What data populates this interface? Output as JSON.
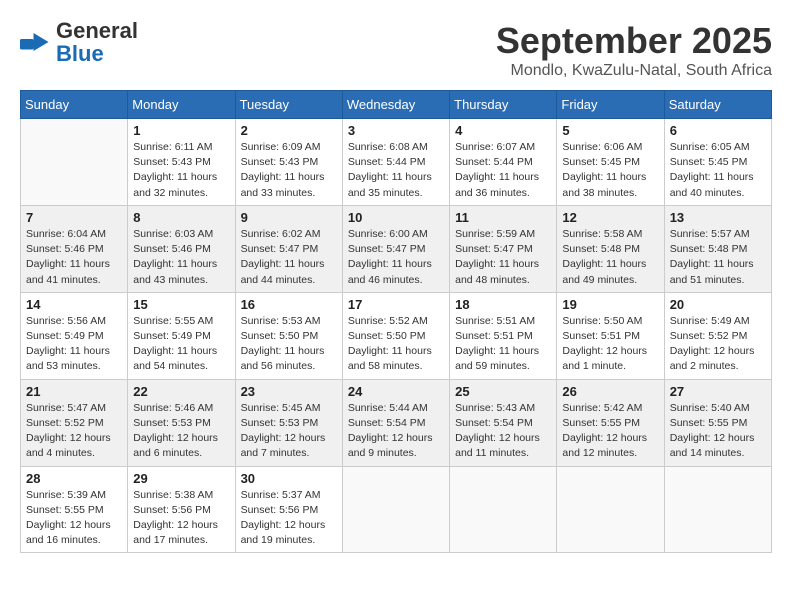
{
  "logo": {
    "text_general": "General",
    "text_blue": "Blue",
    "icon_color": "#1a6bb5"
  },
  "title": "September 2025",
  "location": "Mondlo, KwaZulu-Natal, South Africa",
  "weekdays": [
    "Sunday",
    "Monday",
    "Tuesday",
    "Wednesday",
    "Thursday",
    "Friday",
    "Saturday"
  ],
  "weeks": [
    {
      "shaded": false,
      "days": [
        {
          "num": "",
          "sunrise": "",
          "sunset": "",
          "daylight": ""
        },
        {
          "num": "1",
          "sunrise": "Sunrise: 6:11 AM",
          "sunset": "Sunset: 5:43 PM",
          "daylight": "Daylight: 11 hours and 32 minutes."
        },
        {
          "num": "2",
          "sunrise": "Sunrise: 6:09 AM",
          "sunset": "Sunset: 5:43 PM",
          "daylight": "Daylight: 11 hours and 33 minutes."
        },
        {
          "num": "3",
          "sunrise": "Sunrise: 6:08 AM",
          "sunset": "Sunset: 5:44 PM",
          "daylight": "Daylight: 11 hours and 35 minutes."
        },
        {
          "num": "4",
          "sunrise": "Sunrise: 6:07 AM",
          "sunset": "Sunset: 5:44 PM",
          "daylight": "Daylight: 11 hours and 36 minutes."
        },
        {
          "num": "5",
          "sunrise": "Sunrise: 6:06 AM",
          "sunset": "Sunset: 5:45 PM",
          "daylight": "Daylight: 11 hours and 38 minutes."
        },
        {
          "num": "6",
          "sunrise": "Sunrise: 6:05 AM",
          "sunset": "Sunset: 5:45 PM",
          "daylight": "Daylight: 11 hours and 40 minutes."
        }
      ]
    },
    {
      "shaded": true,
      "days": [
        {
          "num": "7",
          "sunrise": "Sunrise: 6:04 AM",
          "sunset": "Sunset: 5:46 PM",
          "daylight": "Daylight: 11 hours and 41 minutes."
        },
        {
          "num": "8",
          "sunrise": "Sunrise: 6:03 AM",
          "sunset": "Sunset: 5:46 PM",
          "daylight": "Daylight: 11 hours and 43 minutes."
        },
        {
          "num": "9",
          "sunrise": "Sunrise: 6:02 AM",
          "sunset": "Sunset: 5:47 PM",
          "daylight": "Daylight: 11 hours and 44 minutes."
        },
        {
          "num": "10",
          "sunrise": "Sunrise: 6:00 AM",
          "sunset": "Sunset: 5:47 PM",
          "daylight": "Daylight: 11 hours and 46 minutes."
        },
        {
          "num": "11",
          "sunrise": "Sunrise: 5:59 AM",
          "sunset": "Sunset: 5:47 PM",
          "daylight": "Daylight: 11 hours and 48 minutes."
        },
        {
          "num": "12",
          "sunrise": "Sunrise: 5:58 AM",
          "sunset": "Sunset: 5:48 PM",
          "daylight": "Daylight: 11 hours and 49 minutes."
        },
        {
          "num": "13",
          "sunrise": "Sunrise: 5:57 AM",
          "sunset": "Sunset: 5:48 PM",
          "daylight": "Daylight: 11 hours and 51 minutes."
        }
      ]
    },
    {
      "shaded": false,
      "days": [
        {
          "num": "14",
          "sunrise": "Sunrise: 5:56 AM",
          "sunset": "Sunset: 5:49 PM",
          "daylight": "Daylight: 11 hours and 53 minutes."
        },
        {
          "num": "15",
          "sunrise": "Sunrise: 5:55 AM",
          "sunset": "Sunset: 5:49 PM",
          "daylight": "Daylight: 11 hours and 54 minutes."
        },
        {
          "num": "16",
          "sunrise": "Sunrise: 5:53 AM",
          "sunset": "Sunset: 5:50 PM",
          "daylight": "Daylight: 11 hours and 56 minutes."
        },
        {
          "num": "17",
          "sunrise": "Sunrise: 5:52 AM",
          "sunset": "Sunset: 5:50 PM",
          "daylight": "Daylight: 11 hours and 58 minutes."
        },
        {
          "num": "18",
          "sunrise": "Sunrise: 5:51 AM",
          "sunset": "Sunset: 5:51 PM",
          "daylight": "Daylight: 11 hours and 59 minutes."
        },
        {
          "num": "19",
          "sunrise": "Sunrise: 5:50 AM",
          "sunset": "Sunset: 5:51 PM",
          "daylight": "Daylight: 12 hours and 1 minute."
        },
        {
          "num": "20",
          "sunrise": "Sunrise: 5:49 AM",
          "sunset": "Sunset: 5:52 PM",
          "daylight": "Daylight: 12 hours and 2 minutes."
        }
      ]
    },
    {
      "shaded": true,
      "days": [
        {
          "num": "21",
          "sunrise": "Sunrise: 5:47 AM",
          "sunset": "Sunset: 5:52 PM",
          "daylight": "Daylight: 12 hours and 4 minutes."
        },
        {
          "num": "22",
          "sunrise": "Sunrise: 5:46 AM",
          "sunset": "Sunset: 5:53 PM",
          "daylight": "Daylight: 12 hours and 6 minutes."
        },
        {
          "num": "23",
          "sunrise": "Sunrise: 5:45 AM",
          "sunset": "Sunset: 5:53 PM",
          "daylight": "Daylight: 12 hours and 7 minutes."
        },
        {
          "num": "24",
          "sunrise": "Sunrise: 5:44 AM",
          "sunset": "Sunset: 5:54 PM",
          "daylight": "Daylight: 12 hours and 9 minutes."
        },
        {
          "num": "25",
          "sunrise": "Sunrise: 5:43 AM",
          "sunset": "Sunset: 5:54 PM",
          "daylight": "Daylight: 12 hours and 11 minutes."
        },
        {
          "num": "26",
          "sunrise": "Sunrise: 5:42 AM",
          "sunset": "Sunset: 5:55 PM",
          "daylight": "Daylight: 12 hours and 12 minutes."
        },
        {
          "num": "27",
          "sunrise": "Sunrise: 5:40 AM",
          "sunset": "Sunset: 5:55 PM",
          "daylight": "Daylight: 12 hours and 14 minutes."
        }
      ]
    },
    {
      "shaded": false,
      "days": [
        {
          "num": "28",
          "sunrise": "Sunrise: 5:39 AM",
          "sunset": "Sunset: 5:55 PM",
          "daylight": "Daylight: 12 hours and 16 minutes."
        },
        {
          "num": "29",
          "sunrise": "Sunrise: 5:38 AM",
          "sunset": "Sunset: 5:56 PM",
          "daylight": "Daylight: 12 hours and 17 minutes."
        },
        {
          "num": "30",
          "sunrise": "Sunrise: 5:37 AM",
          "sunset": "Sunset: 5:56 PM",
          "daylight": "Daylight: 12 hours and 19 minutes."
        },
        {
          "num": "",
          "sunrise": "",
          "sunset": "",
          "daylight": ""
        },
        {
          "num": "",
          "sunrise": "",
          "sunset": "",
          "daylight": ""
        },
        {
          "num": "",
          "sunrise": "",
          "sunset": "",
          "daylight": ""
        },
        {
          "num": "",
          "sunrise": "",
          "sunset": "",
          "daylight": ""
        }
      ]
    }
  ]
}
